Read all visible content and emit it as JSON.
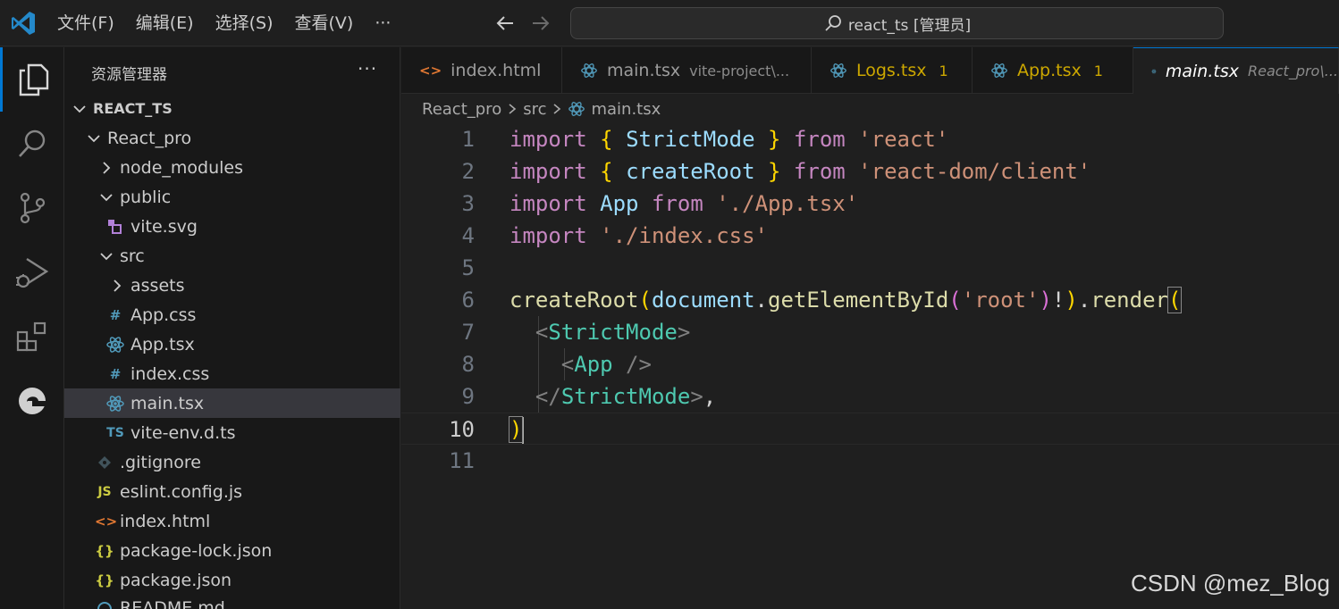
{
  "titlebar": {
    "menu": [
      "文件(F)",
      "编辑(E)",
      "选择(S)",
      "查看(V)",
      "···"
    ],
    "search_text": "react_ts [管理员]"
  },
  "sidebar": {
    "title": "资源管理器",
    "more": "···",
    "root": "REACT_TS",
    "items": [
      {
        "label": "React_pro",
        "icon": "chevron-down-icon"
      },
      {
        "label": "node_modules",
        "icon": "chevron-right-icon"
      },
      {
        "label": "public",
        "icon": "chevron-down-icon"
      },
      {
        "label": "vite.svg",
        "icon": "svg-file-icon"
      },
      {
        "label": "src",
        "icon": "chevron-down-icon"
      },
      {
        "label": "assets",
        "icon": "chevron-right-icon"
      },
      {
        "label": "App.css",
        "icon": "css-file-icon",
        "glyph": "#"
      },
      {
        "label": "App.tsx",
        "icon": "react-file-icon"
      },
      {
        "label": "index.css",
        "icon": "css-file-icon",
        "glyph": "#"
      },
      {
        "label": "main.tsx",
        "icon": "react-file-icon"
      },
      {
        "label": "vite-env.d.ts",
        "icon": "ts-file-icon",
        "glyph": "TS"
      },
      {
        "label": ".gitignore",
        "icon": "git-file-icon"
      },
      {
        "label": "eslint.config.js",
        "icon": "js-file-icon",
        "glyph": "JS"
      },
      {
        "label": "index.html",
        "icon": "html-file-icon",
        "glyph": "<>"
      },
      {
        "label": "package-lock.json",
        "icon": "json-file-icon",
        "glyph": "{}"
      },
      {
        "label": "package.json",
        "icon": "json-file-icon",
        "glyph": "{}"
      },
      {
        "label": "README.md",
        "icon": "info-file-icon"
      }
    ]
  },
  "tabs": [
    {
      "name": "index.html",
      "desc": "",
      "badge": ""
    },
    {
      "name": "main.tsx",
      "desc": "vite-project\\...",
      "badge": ""
    },
    {
      "name": "Logs.tsx",
      "desc": "",
      "badge": "1"
    },
    {
      "name": "App.tsx",
      "desc": "",
      "badge": "1"
    },
    {
      "name": "main.tsx",
      "desc": "React_pro\\..."
    }
  ],
  "breadcrumb": [
    "React_pro",
    "src",
    "main.tsx"
  ],
  "editor": {
    "line_numbers": [
      "1",
      "2",
      "3",
      "4",
      "5",
      "6",
      "7",
      "8",
      "9",
      "10",
      "11"
    ],
    "lines": {
      "l1": [
        "import",
        "{",
        "StrictMode",
        "}",
        "from",
        "'react'"
      ],
      "l2": [
        "import",
        "{",
        "createRoot",
        "}",
        "from",
        "'react-dom/client'"
      ],
      "l3": [
        "import",
        "App",
        "from",
        "'./App.tsx'"
      ],
      "l4": [
        "import",
        "'./index.css'"
      ],
      "l6": [
        "createRoot",
        "(",
        "document",
        ".",
        "getElementById",
        "(",
        "'root'",
        ")",
        "!",
        ")",
        ".",
        "render",
        "("
      ],
      "l7": [
        "<",
        "StrictMode",
        ">"
      ],
      "l8": [
        "<",
        "App",
        " />"
      ],
      "l9": [
        "</",
        "StrictMode",
        ">",
        ","
      ],
      "l10": [
        ")"
      ]
    }
  },
  "watermark": "CSDN @mez_Blog",
  "colors": {
    "accent": "#0078d4",
    "keyword": "#c586c0",
    "string": "#ce9178",
    "type": "#4ec9b0",
    "variable": "#9cdcfe",
    "function": "#dcdcaa",
    "bracket_gold": "#ffd700",
    "warning": "#cca700"
  }
}
